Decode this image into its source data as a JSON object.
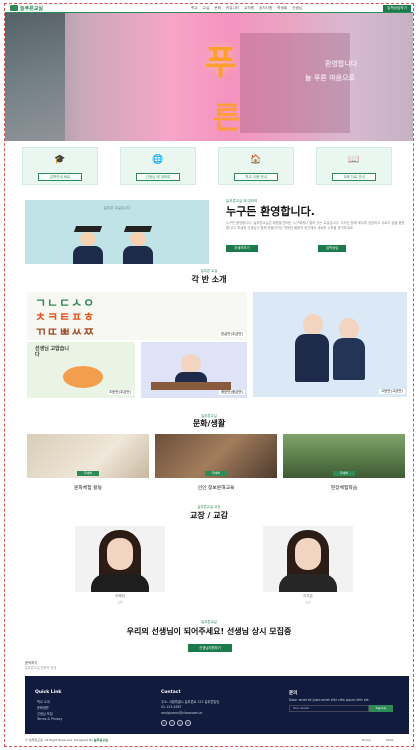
{
  "header": {
    "logo_text": "늘푸른교실",
    "nav": [
      "학교",
      "교실",
      "문화",
      "커뮤니티",
      "교직원",
      "공지사항",
      "학생회",
      "선생님",
      "공지"
    ],
    "apply": "입학상담하기"
  },
  "hero": {
    "title_top": "푸",
    "title_bottom": "른",
    "overlay_a": "환영합니다",
    "overlay_b": "늘 푸른 마음으로"
  },
  "quick_links": [
    {
      "icon": "graduation-cap-icon",
      "glyph": "🎓",
      "label": "입학안내 바로"
    },
    {
      "icon": "globe-icon",
      "glyph": "🌐",
      "label": "선생님 에 대하여"
    },
    {
      "icon": "house-icon",
      "glyph": "🏠",
      "label": "학교 이용 안내"
    },
    {
      "icon": "book-icon",
      "glyph": "📖",
      "label": "교육 자료 안내"
    }
  ],
  "welcome": {
    "image_caption": "늘푸른 교실입니다",
    "tag": "늘푸른교실 에 대하여",
    "title": "누구든 환영합니다.",
    "body": "누구든 환영합니다. 늘푸른교실은 배움을 원하는 누구에게나 열려 있는 교실입니다. 우리는 함께 배우며 성장하고 서로의 꿈을 응원합니다. 학생과 선생님이 함께 만들어가는 따뜻한 배움의 공간에서 새로운 시작을 맞이하세요.",
    "btn1": "자세히보기",
    "btn2": "입학상담"
  },
  "classes": {
    "tag": "늘푸른 교실",
    "title": "각 반 소개",
    "letters": [
      "ㄱㄴㄷㅅㅇ",
      "ㅊㅋㅌㅍㅎ",
      "ㄲㄸㅃㅆㅉ"
    ],
    "thanks_text": "선생님 고맙습니다",
    "items": [
      "한글반(초급반)",
      "초등반(초급반)",
      "중등반(중급반)",
      "고등반(고급반)"
    ]
  },
  "culture": {
    "tag": "늘푸른교실",
    "title": "문화/생활",
    "pill": "자세히",
    "items": [
      "문화체험 활동",
      "선안 정보문해교육",
      "현장체험학습"
    ]
  },
  "staff": {
    "tag": "늘푸른교실 교장",
    "title": "교장 / 교감",
    "people": [
      {
        "name": "이혜지",
        "role": "교장"
      },
      {
        "name": "이지은",
        "role": "교감"
      }
    ]
  },
  "recruit": {
    "tag": "늘푸른교실",
    "title": "우리의 선생님이 되어주세요! 선생님 상시 모집중",
    "btn": "선생님지원하기",
    "contact_a": "문의하기",
    "contact_b": "늘푸른교실 연락처 안내"
  },
  "footer": {
    "quick_title": "Quick Link",
    "quick_links": [
      "학교 소개",
      "문화생활",
      "선생님 모집",
      "Terms & Privacy"
    ],
    "contact_title": "Contact",
    "contact_lines": [
      "주소: 서울특별시 늘푸른로 123 늘푸른빌딩",
      "02-123-4567",
      "neulpureun@classroom.kr"
    ],
    "news_title": "문의",
    "news_text": "Dolor amet sit justo amet elitr clita ipsum elitr est.",
    "news_placeholder": "Your email",
    "news_btn": "SignUp",
    "social": [
      "t",
      "f",
      "y",
      "in"
    ],
    "copyright": "© 늘푸른교실, All Right Reserved. Designed By",
    "copyright_brand": "늘푸른교실",
    "home": "Home",
    "faqs": "FAQs"
  }
}
